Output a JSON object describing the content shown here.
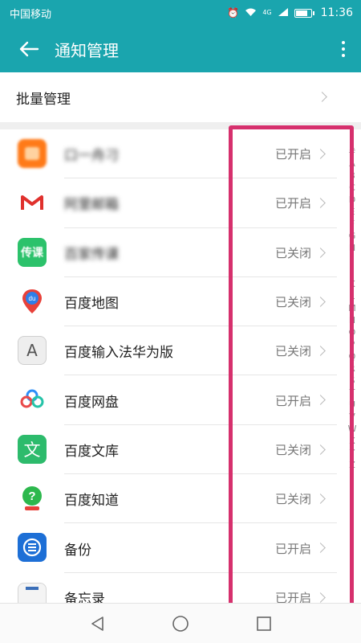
{
  "status_bar": {
    "carrier": "中国移动",
    "network": "4G",
    "time": "11:36"
  },
  "app_bar": {
    "title": "通知管理"
  },
  "batch": {
    "label": "批量管理"
  },
  "apps": [
    {
      "name": "口一舟刁",
      "status": "已开启",
      "icon": "orange-app-icon",
      "blurred": true
    },
    {
      "name": "阿里邮箱",
      "status": "已开启",
      "icon": "mail-app-icon",
      "blurred": true
    },
    {
      "name": "百家传课",
      "status": "已关闭",
      "icon": "chuanke-app-icon",
      "blurred": true
    },
    {
      "name": "百度地图",
      "status": "已关闭",
      "icon": "baidu-map-icon",
      "blurred": false
    },
    {
      "name": "百度输入法华为版",
      "status": "已关闭",
      "icon": "baidu-input-icon",
      "blurred": false
    },
    {
      "name": "百度网盘",
      "status": "已开启",
      "icon": "baidu-netdisk-icon",
      "blurred": false
    },
    {
      "name": "百度文库",
      "status": "已关闭",
      "icon": "baidu-wenku-icon",
      "blurred": false
    },
    {
      "name": "百度知道",
      "status": "已关闭",
      "icon": "baidu-zhidao-icon",
      "blurred": false
    },
    {
      "name": "备份",
      "status": "已开启",
      "icon": "backup-icon",
      "blurred": false
    },
    {
      "name": "备忘录",
      "status": "已开启",
      "icon": "memo-icon",
      "blurred": false
    }
  ],
  "index_letters": [
    "#",
    "A",
    "B",
    "C",
    "D",
    "E",
    "F",
    "G",
    "H",
    "I",
    "J",
    "K",
    "L",
    "M",
    "N",
    "O",
    "P",
    "Q",
    "R",
    "S",
    "T",
    "U",
    "V",
    "W",
    "X",
    "Y",
    "Z"
  ],
  "colors": {
    "accent": "#1aa5ae",
    "highlight": "#d6306d"
  }
}
